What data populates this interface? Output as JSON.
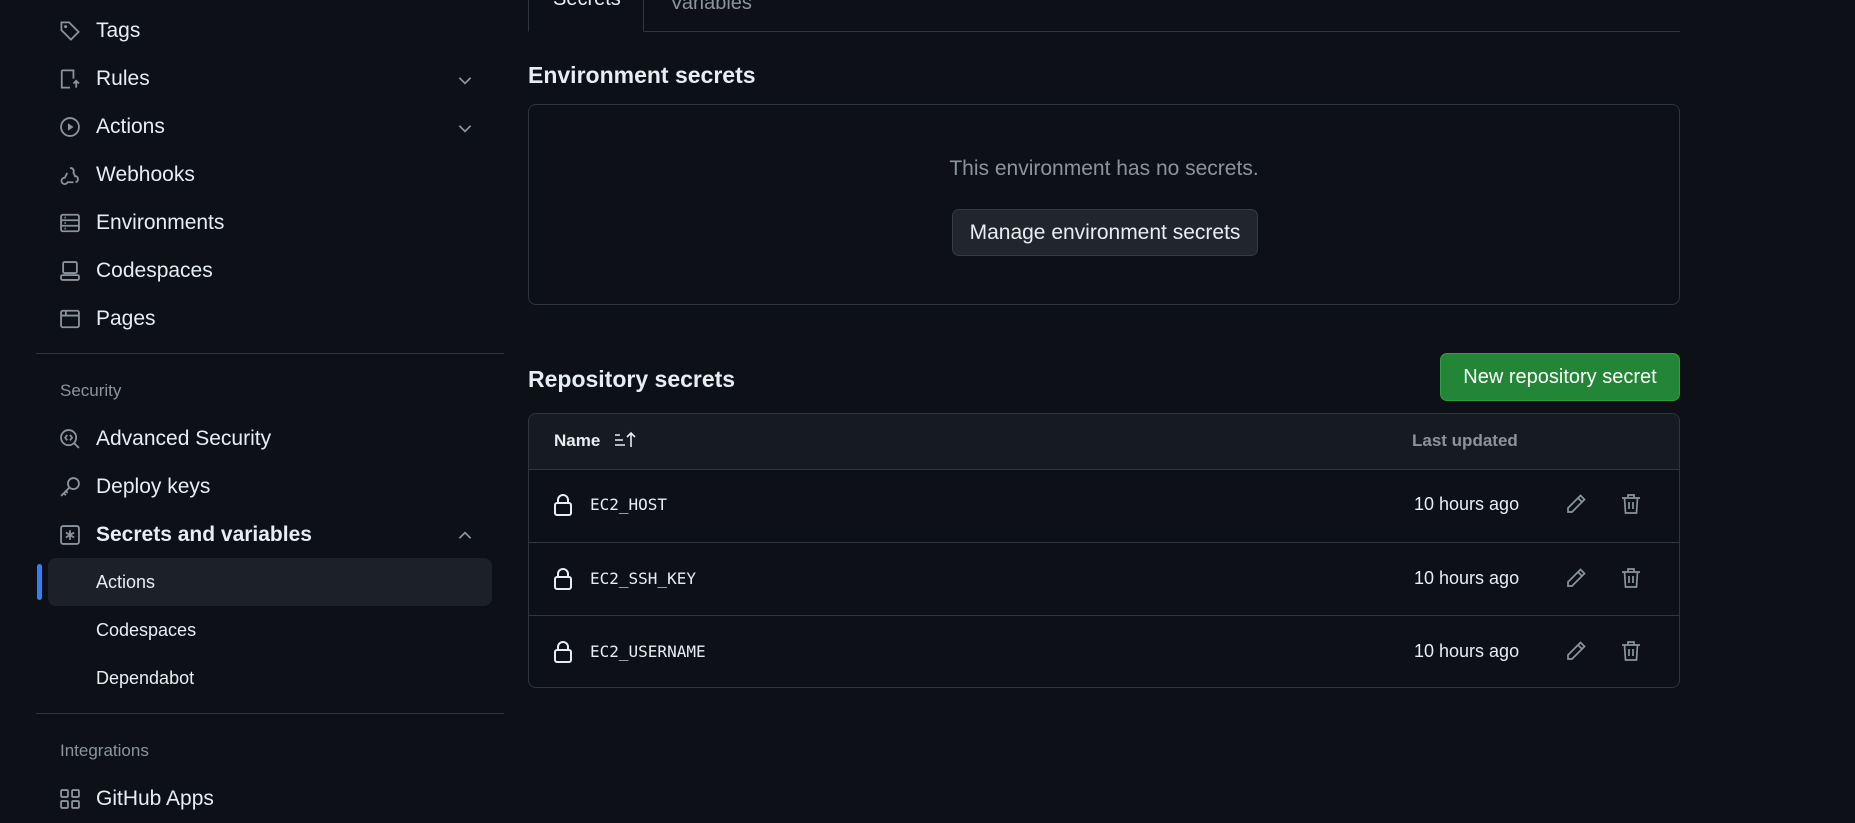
{
  "sidebar": {
    "items": [
      {
        "label": "Tags",
        "icon": "tag-icon"
      },
      {
        "label": "Rules",
        "icon": "rules-icon",
        "expandable": true
      },
      {
        "label": "Actions",
        "icon": "play-icon",
        "expandable": true
      },
      {
        "label": "Webhooks",
        "icon": "webhook-icon"
      },
      {
        "label": "Environments",
        "icon": "server-icon"
      },
      {
        "label": "Codespaces",
        "icon": "codespaces-icon"
      },
      {
        "label": "Pages",
        "icon": "browser-icon"
      }
    ],
    "security_label": "Security",
    "security_items": [
      {
        "label": "Advanced Security",
        "icon": "codescan-icon"
      },
      {
        "label": "Deploy keys",
        "icon": "key-icon"
      },
      {
        "label": "Secrets and variables",
        "icon": "asterisk-icon",
        "expanded": true
      }
    ],
    "sub_items": [
      {
        "label": "Actions",
        "active": true
      },
      {
        "label": "Codespaces"
      },
      {
        "label": "Dependabot"
      }
    ],
    "integrations_label": "Integrations",
    "integrations_items": [
      {
        "label": "GitHub Apps",
        "icon": "apps-icon"
      }
    ]
  },
  "tabs": {
    "secrets": "Secrets",
    "variables": "Variables"
  },
  "environment": {
    "title": "Environment secrets",
    "empty_text": "This environment has no secrets.",
    "manage_button": "Manage environment secrets"
  },
  "repository": {
    "title": "Repository secrets",
    "new_button": "New repository secret",
    "columns": {
      "name": "Name",
      "updated": "Last updated"
    },
    "rows": [
      {
        "name": "EC2_HOST",
        "updated": "10 hours ago"
      },
      {
        "name": "EC2_SSH_KEY",
        "updated": "10 hours ago"
      },
      {
        "name": "EC2_USERNAME",
        "updated": "10 hours ago"
      }
    ]
  },
  "colors": {
    "background": "#0d1117",
    "border": "#30363d",
    "accent": "#2f81f7",
    "primary_button": "#238636",
    "muted_text": "#8b949e"
  }
}
